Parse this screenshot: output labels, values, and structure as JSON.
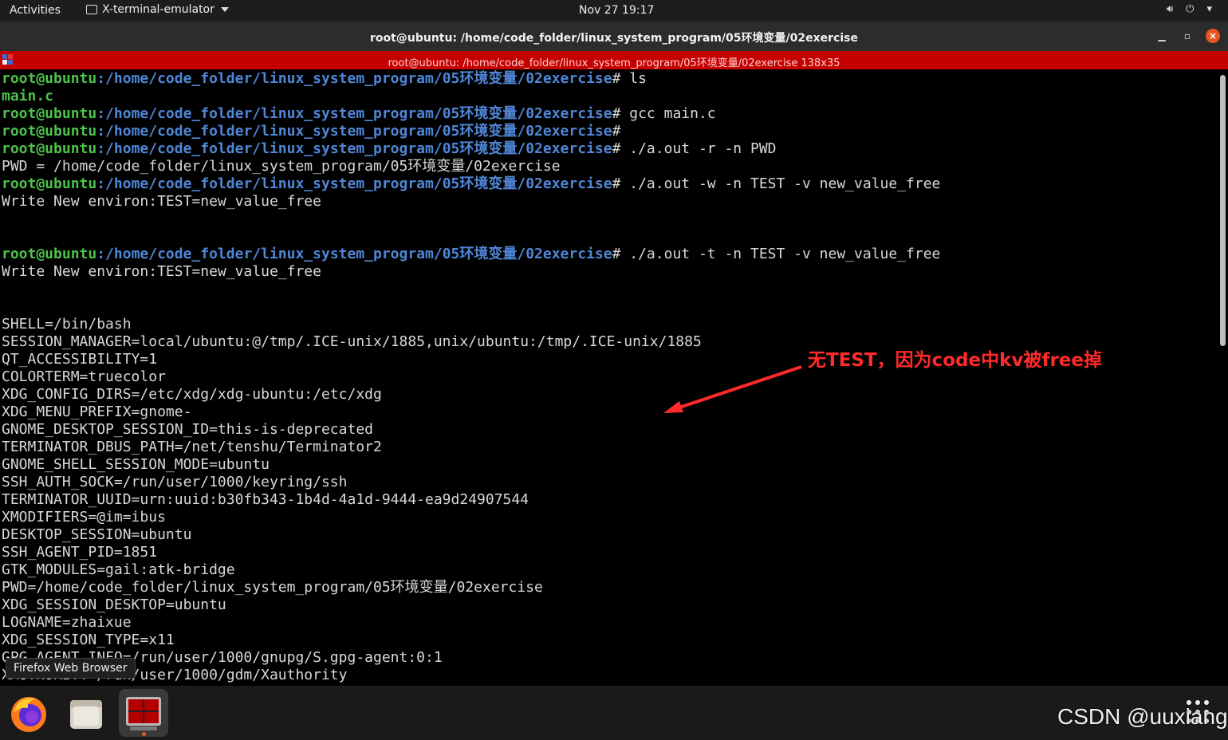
{
  "topbar": {
    "activities": "Activities",
    "app_name": "X-terminal-emulator",
    "clock": "Nov 27  19:17"
  },
  "window": {
    "title": "root@ubuntu: /home/code_folder/linux_system_program/05环境变量/02exercise"
  },
  "terminator": {
    "header": "root@ubuntu: /home/code_folder/linux_system_program/05环境变量/02exercise 138x35"
  },
  "terminal": {
    "prompt_user": "root@ubuntu",
    "prompt_path": ":/home/code_folder/linux_system_program/05环境变量/02exercise",
    "prompt_suffix": "#",
    "lines": [
      {
        "kind": "prompt",
        "cmd": " ls"
      },
      {
        "kind": "ok",
        "text": "main.c"
      },
      {
        "kind": "prompt",
        "cmd": " gcc main.c"
      },
      {
        "kind": "prompt",
        "cmd": ""
      },
      {
        "kind": "prompt",
        "cmd": " ./a.out -r -n PWD"
      },
      {
        "kind": "out",
        "text": "PWD = /home/code_folder/linux_system_program/05环境变量/02exercise"
      },
      {
        "kind": "prompt",
        "cmd": " ./a.out -w -n TEST -v new_value_free"
      },
      {
        "kind": "out",
        "text": "Write New environ:TEST=new_value_free"
      },
      {
        "kind": "out",
        "text": ""
      },
      {
        "kind": "out",
        "text": ""
      },
      {
        "kind": "prompt",
        "cmd": " ./a.out -t -n TEST -v new_value_free"
      },
      {
        "kind": "out",
        "text": "Write New environ:TEST=new_value_free"
      },
      {
        "kind": "out",
        "text": ""
      },
      {
        "kind": "out",
        "text": ""
      },
      {
        "kind": "out",
        "text": "SHELL=/bin/bash"
      },
      {
        "kind": "out",
        "text": "SESSION_MANAGER=local/ubuntu:@/tmp/.ICE-unix/1885,unix/ubuntu:/tmp/.ICE-unix/1885"
      },
      {
        "kind": "out",
        "text": "QT_ACCESSIBILITY=1"
      },
      {
        "kind": "out",
        "text": "COLORTERM=truecolor"
      },
      {
        "kind": "out",
        "text": "XDG_CONFIG_DIRS=/etc/xdg/xdg-ubuntu:/etc/xdg"
      },
      {
        "kind": "out",
        "text": "XDG_MENU_PREFIX=gnome-"
      },
      {
        "kind": "out",
        "text": "GNOME_DESKTOP_SESSION_ID=this-is-deprecated"
      },
      {
        "kind": "out",
        "text": "TERMINATOR_DBUS_PATH=/net/tenshu/Terminator2"
      },
      {
        "kind": "out",
        "text": "GNOME_SHELL_SESSION_MODE=ubuntu"
      },
      {
        "kind": "out",
        "text": "SSH_AUTH_SOCK=/run/user/1000/keyring/ssh"
      },
      {
        "kind": "out",
        "text": "TERMINATOR_UUID=urn:uuid:b30fb343-1b4d-4a1d-9444-ea9d24907544"
      },
      {
        "kind": "out",
        "text": "XMODIFIERS=@im=ibus"
      },
      {
        "kind": "out",
        "text": "DESKTOP_SESSION=ubuntu"
      },
      {
        "kind": "out",
        "text": "SSH_AGENT_PID=1851"
      },
      {
        "kind": "out",
        "text": "GTK_MODULES=gail:atk-bridge"
      },
      {
        "kind": "out",
        "text": "PWD=/home/code_folder/linux_system_program/05环境变量/02exercise"
      },
      {
        "kind": "out",
        "text": "XDG_SESSION_DESKTOP=ubuntu"
      },
      {
        "kind": "out",
        "text": "LOGNAME=zhaixue"
      },
      {
        "kind": "out",
        "text": "XDG_SESSION_TYPE=x11"
      },
      {
        "kind": "out",
        "text": "GPG_AGENT_INFO=/run/user/1000/gnupg/S.gpg-agent:0:1"
      },
      {
        "kind": "out",
        "text": "XAUTHORITY=/run/user/1000/gdm/Xauthority"
      }
    ]
  },
  "annotation": {
    "text": "无TEST，因为code中kv被free掉",
    "color": "#ff2a2a"
  },
  "tooltip": "Firefox Web Browser",
  "dock": {
    "items": [
      "firefox-icon",
      "files-icon",
      "terminator-icon"
    ]
  },
  "watermark": "CSDN @uuxiang"
}
